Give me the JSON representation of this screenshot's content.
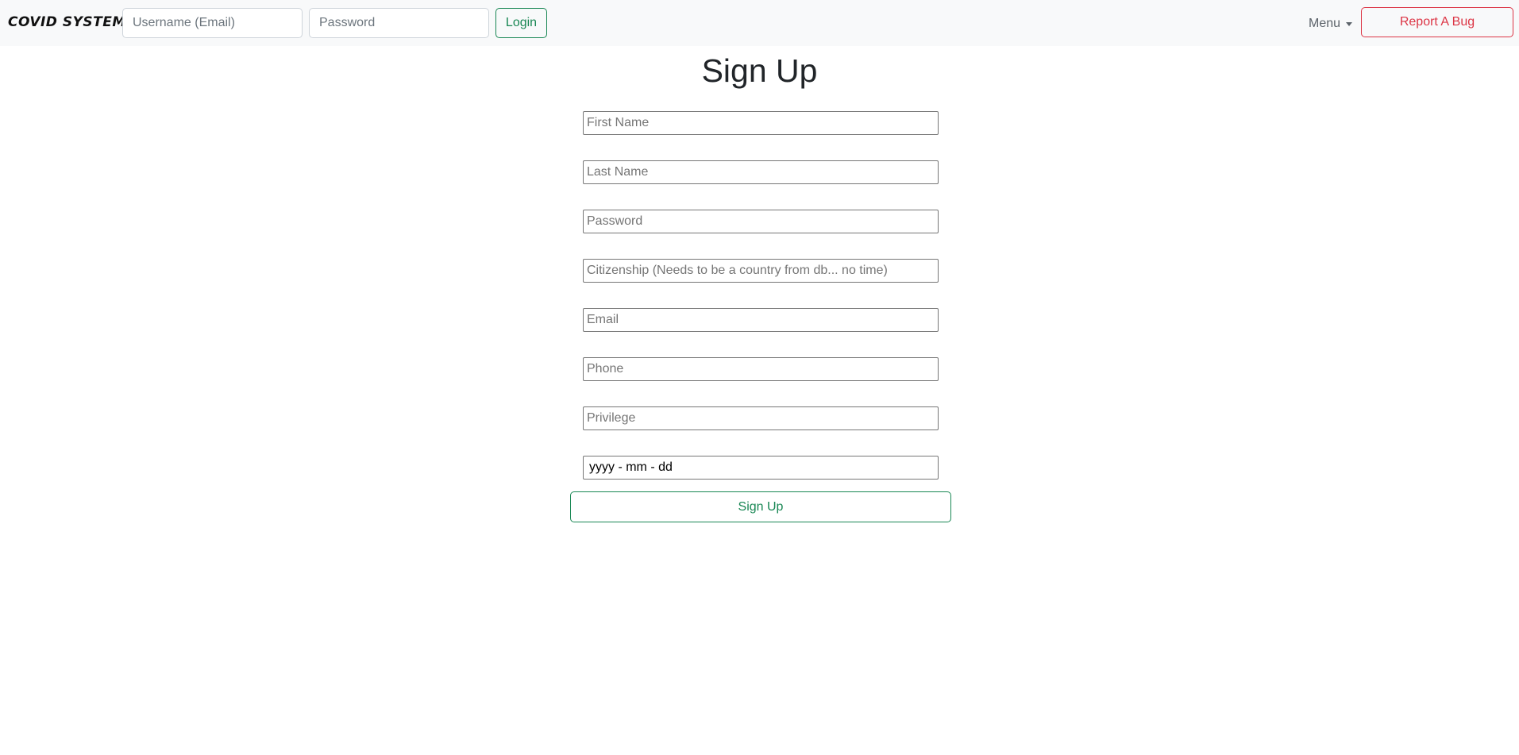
{
  "navbar": {
    "brand": "COVID SYSTEM",
    "username_placeholder": "Username (Email)",
    "password_placeholder": "Password",
    "login_label": "Login",
    "menu_label": "Menu",
    "report_bug_label": "Report A Bug"
  },
  "page": {
    "title": "Sign Up"
  },
  "form": {
    "first_name_placeholder": "First Name",
    "last_name_placeholder": "Last Name",
    "password_placeholder": "Password",
    "citizenship_placeholder": "Citizenship (Needs to be a country from db... no time)",
    "email_placeholder": "Email",
    "phone_placeholder": "Phone",
    "privilege_placeholder": "Privilege",
    "date_value": "yyyy - mm - dd",
    "submit_label": "Sign Up"
  },
  "colors": {
    "success": "#198754",
    "danger": "#dc3545",
    "navbar_bg": "#f8f9fa"
  }
}
